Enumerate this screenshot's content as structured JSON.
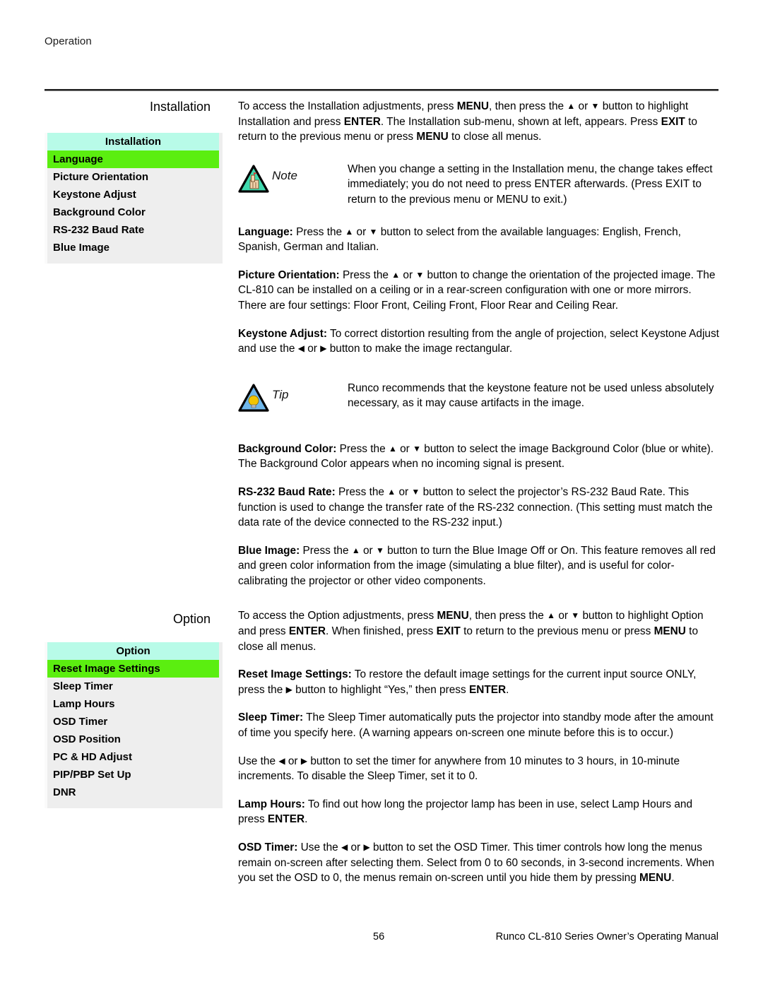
{
  "page": {
    "running_head": "Operation",
    "footer_page_number": "56",
    "footer_title": "Runco CL-810 Series Owner’s Operating Manual"
  },
  "colors": {
    "osd_title_bg": "#b8fbe8",
    "osd_selected_bg": "#5bee10",
    "osd_box_bg": "#eeeeee",
    "note_triangle": "#3fd9ae",
    "tip_triangle": "#6fb7ea",
    "tip_bulb": "#f2c500"
  },
  "installation": {
    "heading": "Installation",
    "menu": {
      "title": "Installation",
      "items": [
        {
          "label": "Language",
          "selected": true
        },
        {
          "label": "Picture Orientation",
          "selected": false
        },
        {
          "label": "Keystone Adjust",
          "selected": false
        },
        {
          "label": "Background Color",
          "selected": false
        },
        {
          "label": "RS-232 Baud Rate",
          "selected": false
        },
        {
          "label": "Blue Image",
          "selected": false
        }
      ]
    },
    "intro_p1": "To access the Installation adjustments, press MENU, then press the ▲ or ▼ button to highlight Installation and press ENTER. The Installation sub-menu, shown at left, appears. Press EXIT to return to the previous menu or press MENU to close all menus.",
    "note": {
      "label": "Note",
      "icon": "note-triangle-hand-icon",
      "body": "When you change a setting in the Installation menu, the change takes effect immediately; you do not need to press ENTER afterwards. (Press EXIT to return to the previous menu or MENU to exit.)"
    },
    "tip": {
      "label": "Tip",
      "icon": "tip-triangle-lightbulb-icon",
      "body": "Runco recommends that the keystone feature not be used unless absolutely necessary, as it may cause artifacts in the image."
    },
    "paragraphs": [
      {
        "term": "Language:",
        "text": " Press the ▲ or ▼ button to select from the available languages: English, French, Spanish, German and Italian."
      },
      {
        "term": "Picture Orientation:",
        "text": " Press the ▲ or ▼ button to change the orientation of the projected image. The CL-810 can be installed on a ceiling or in a rear-screen configuration with one or more mirrors. There are four settings: Floor Front, Ceiling Front, Floor Rear and Ceiling Rear."
      },
      {
        "term": "Keystone Adjust:",
        "text": " To correct distortion resulting from the angle of projection, select Keystone Adjust and use the ◀ or ▶ button to make the image rectangular."
      },
      {
        "term": "Background Color:",
        "text": " Press the ▲ or ▼ button to select the image Background Color (blue or white). The Background Color appears when no incoming signal is present."
      },
      {
        "term": "RS-232 Baud Rate:",
        "text": " Press the ▲ or ▼ button to select the projector’s RS-232 Baud Rate. This function is used to change the transfer rate of the RS-232 connection. (This setting must match the data rate of the device connected to the RS-232 input.)"
      },
      {
        "term": "Blue Image:",
        "text": " Press the ▲ or ▼ button to turn the Blue Image Off or On. This feature removes all red and green color information from the image (simulating a blue filter), and is useful for color-calibrating the projector or other video components."
      }
    ]
  },
  "option": {
    "heading": "Option",
    "menu": {
      "title": "Option",
      "items": [
        {
          "label": "Reset Image Settings",
          "selected": true
        },
        {
          "label": "Sleep Timer",
          "selected": false
        },
        {
          "label": "Lamp Hours",
          "selected": false
        },
        {
          "label": "OSD Timer",
          "selected": false
        },
        {
          "label": "OSD Position",
          "selected": false
        },
        {
          "label": "PC & HD Adjust",
          "selected": false
        },
        {
          "label": "PIP/PBP Set Up",
          "selected": false
        },
        {
          "label": "DNR",
          "selected": false
        }
      ]
    },
    "intro_p1": "To access the Option adjustments, press MENU, then press the ▲ or ▼ button to highlight Option and press ENTER. When finished, press EXIT to return to the previous menu or press MENU to close all menus.",
    "paragraphs": [
      {
        "term": "Reset Image Settings:",
        "text": " To restore the default image settings for the current input source ONLY, press the ▶ button to highlight “Yes,” then press ENTER."
      },
      {
        "term": "Sleep Timer:",
        "text": " The Sleep Timer automatically puts the projector into standby mode after the amount of time you specify here. (A warning appears on-screen one minute before this is to occur.)"
      },
      {
        "term": "",
        "text": "Use the ◀ or ▶ button to set the timer for anywhere from 10 minutes to 3 hours, in 10-minute increments. To disable the Sleep Timer, set it to 0."
      },
      {
        "term": "Lamp Hours:",
        "text": " To find out how long the projector lamp has been in use, select Lamp Hours and press ENTER."
      },
      {
        "term": "OSD Timer:",
        "text": " Use the ◀ or ▶ button to set the OSD Timer. This timer controls how long the menus remain on-screen after selecting them. Select from 0 to 60 seconds, in 3-second increments. When you set the OSD to 0, the menus remain on-screen until you hide them by pressing MENU."
      }
    ]
  }
}
